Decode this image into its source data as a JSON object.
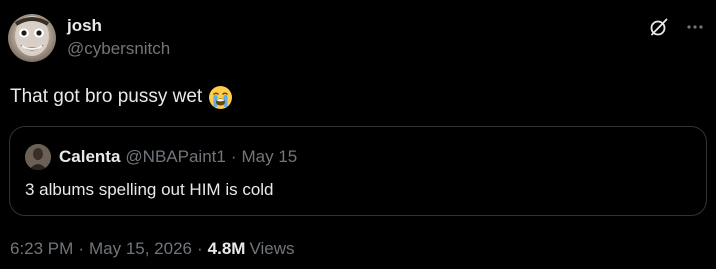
{
  "author": {
    "name": "josh",
    "handle": "@cybersnitch"
  },
  "tweet": {
    "text": "That got bro pussy wet",
    "emoji": "loudly-crying-face"
  },
  "quote": {
    "name": "Calenta",
    "handle": "@NBAPaint1",
    "separator": "·",
    "date": "May 15",
    "text": "3 albums spelling out HIM is cold"
  },
  "meta": {
    "time": "6:23 PM",
    "separator": "·",
    "date": "May 15, 2026",
    "views_count": "4.8M",
    "views_label": "Views"
  },
  "icons": {
    "grok": "grok-icon",
    "more": "more-options-icon"
  },
  "colors": {
    "background": "#000000",
    "text_primary": "#e7e9ea",
    "text_secondary": "#71767b",
    "border": "#2f3336"
  }
}
